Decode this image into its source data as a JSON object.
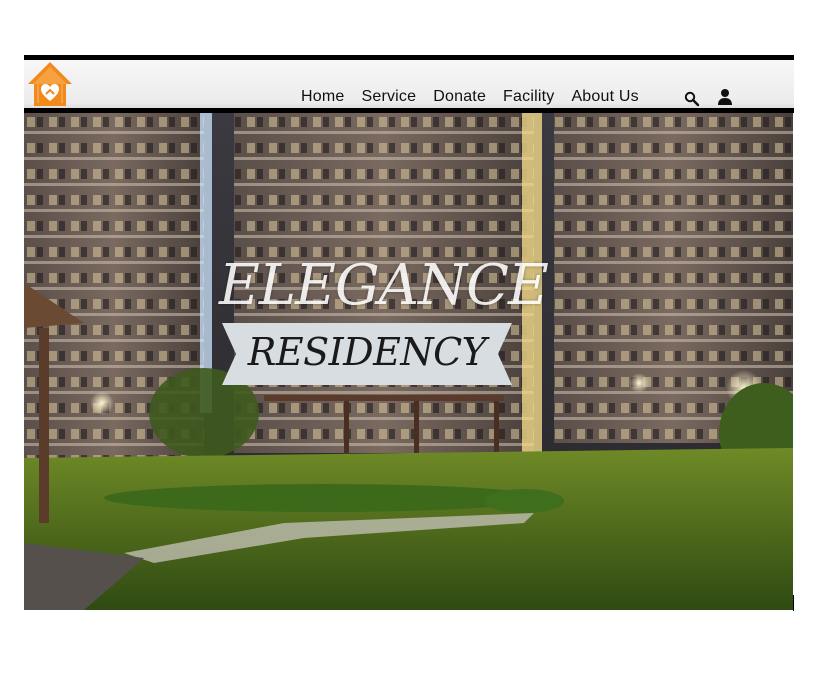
{
  "nav": {
    "items": [
      {
        "label": "Home"
      },
      {
        "label": "Service"
      },
      {
        "label": "Donate"
      },
      {
        "label": "Facility"
      },
      {
        "label": "About Us"
      }
    ],
    "search_icon": "search-icon",
    "user_icon": "user-icon"
  },
  "brand": {
    "logo_icon": "house-heart-logo",
    "accent": "#f08a1c"
  },
  "hero": {
    "title_line1": "ELEGANCE",
    "title_line2": "RESIDENCY"
  }
}
